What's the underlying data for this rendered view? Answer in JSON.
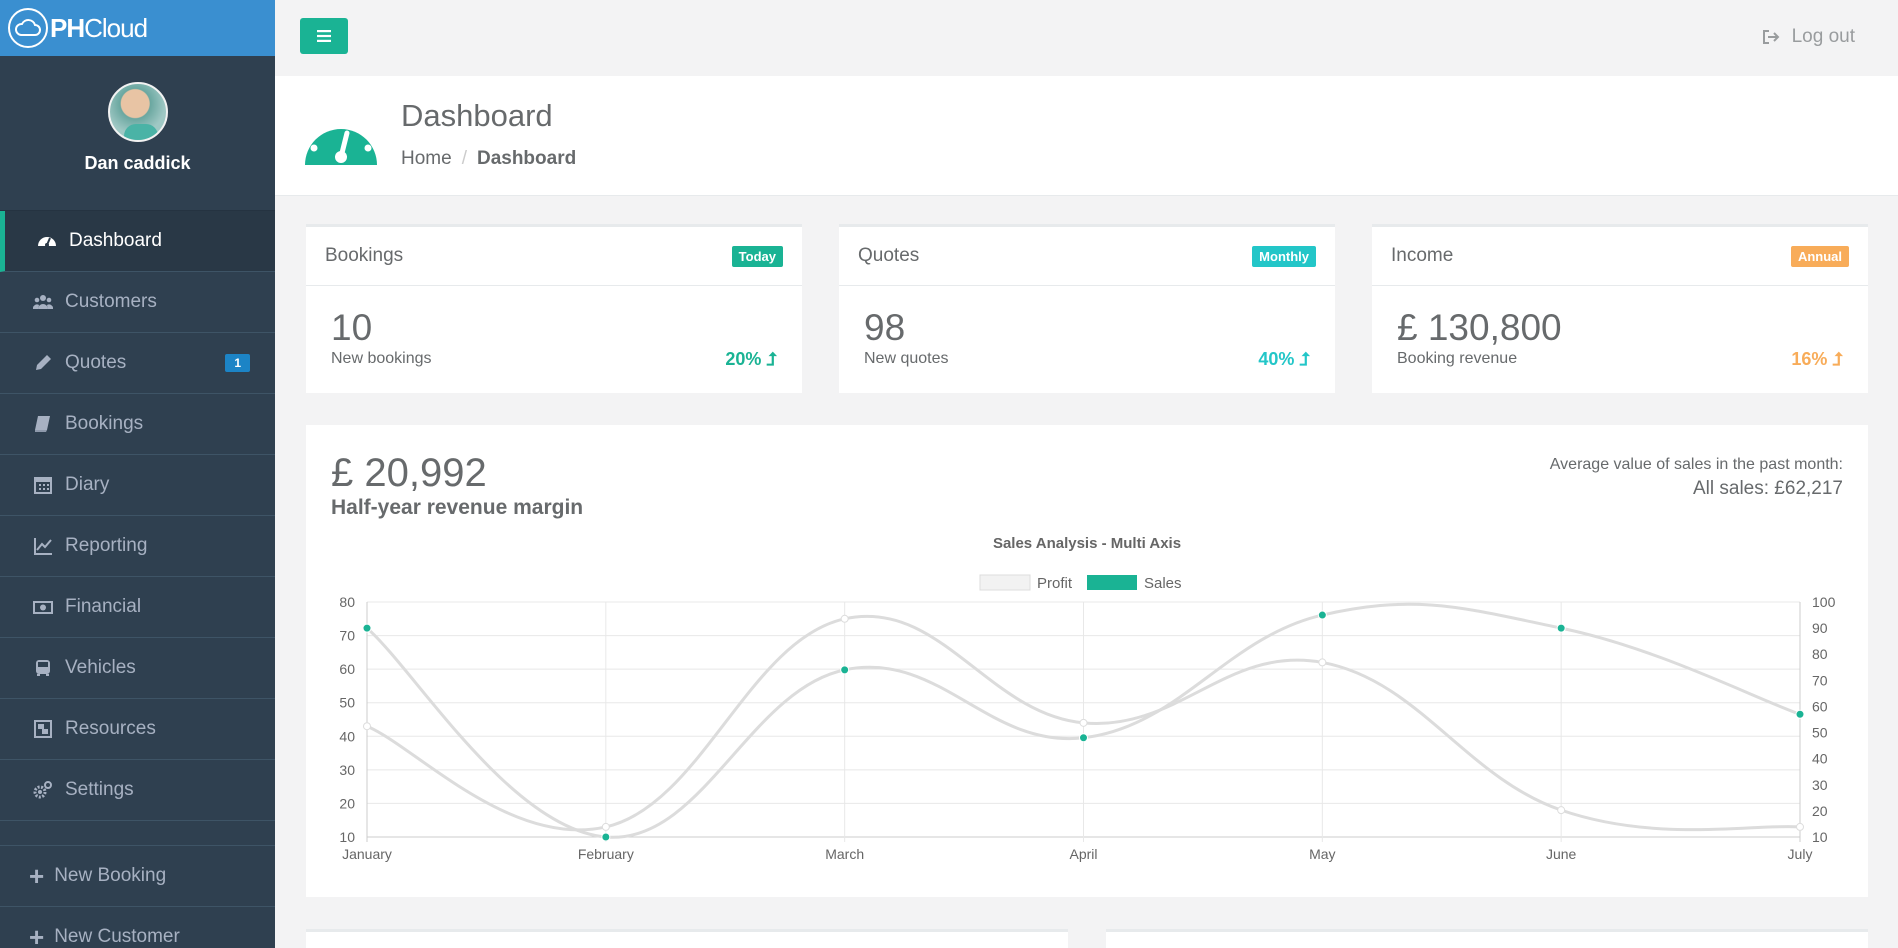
{
  "brand": {
    "name_bold": "PH",
    "name_rest": "Cloud"
  },
  "profile": {
    "name": "Dan caddick"
  },
  "nav": [
    {
      "key": "dashboard",
      "label": "Dashboard",
      "icon": "tachometer-icon",
      "active": true
    },
    {
      "key": "customers",
      "label": "Customers",
      "icon": "users-icon"
    },
    {
      "key": "quotes",
      "label": "Quotes",
      "icon": "pencil-icon",
      "badge": "1"
    },
    {
      "key": "bookings",
      "label": "Bookings",
      "icon": "book-icon"
    },
    {
      "key": "diary",
      "label": "Diary",
      "icon": "calendar-icon"
    },
    {
      "key": "reporting",
      "label": "Reporting",
      "icon": "line-chart-icon"
    },
    {
      "key": "financial",
      "label": "Financial",
      "icon": "money-icon"
    },
    {
      "key": "vehicles",
      "label": "Vehicles",
      "icon": "bus-icon"
    },
    {
      "key": "resources",
      "label": "Resources",
      "icon": "object-group-icon"
    },
    {
      "key": "settings",
      "label": "Settings",
      "icon": "cogs-icon"
    }
  ],
  "nav_actions": [
    {
      "key": "new-booking",
      "label": "New Booking"
    },
    {
      "key": "new-customer",
      "label": "New Customer"
    }
  ],
  "topbar": {
    "logout_label": "Log out"
  },
  "header": {
    "title": "Dashboard",
    "breadcrumb_home": "Home",
    "breadcrumb_current": "Dashboard"
  },
  "cards": [
    {
      "title": "Bookings",
      "label": "Today",
      "label_color": "#1ab394",
      "value": "10",
      "sub": "New bookings",
      "pct": "20%",
      "pct_color": "#1ab394"
    },
    {
      "title": "Quotes",
      "label": "Monthly",
      "label_color": "#23c6c8",
      "value": "98",
      "sub": "New quotes",
      "pct": "40%",
      "pct_color": "#23c6c8"
    },
    {
      "title": "Income",
      "label": "Annual",
      "label_color": "#f8ac59",
      "value": "£ 130,800",
      "sub": "Booking revenue",
      "pct": "16%",
      "pct_color": "#f8ac59"
    }
  ],
  "revenue": {
    "value": "£ 20,992",
    "label": "Half-year revenue margin",
    "avg_label": "Average value of sales in the past month:",
    "avg_value": "All sales: £62,217"
  },
  "colors": {
    "accent": "#1ab394",
    "sidebar": "#2f4050",
    "brand_bar": "#3a8fd0"
  },
  "chart_data": {
    "type": "line",
    "title": "Sales Analysis - Multi Axis",
    "categories": [
      "January",
      "February",
      "March",
      "April",
      "May",
      "June",
      "July"
    ],
    "series": [
      {
        "name": "Profit",
        "axis": "left",
        "values": [
          43,
          13,
          75,
          44,
          62,
          18,
          13
        ]
      },
      {
        "name": "Sales",
        "axis": "right",
        "values": [
          90,
          10,
          74,
          48,
          95,
          90,
          57
        ]
      }
    ],
    "y_left": {
      "min": 10,
      "max": 80,
      "ticks": [
        80,
        70,
        60,
        50,
        40,
        30,
        20,
        10
      ]
    },
    "y_right": {
      "min": 10,
      "max": 100,
      "ticks": [
        100,
        90,
        80,
        70,
        60,
        50,
        40,
        30,
        20,
        10
      ]
    },
    "legend": "top-center",
    "grid": true
  }
}
